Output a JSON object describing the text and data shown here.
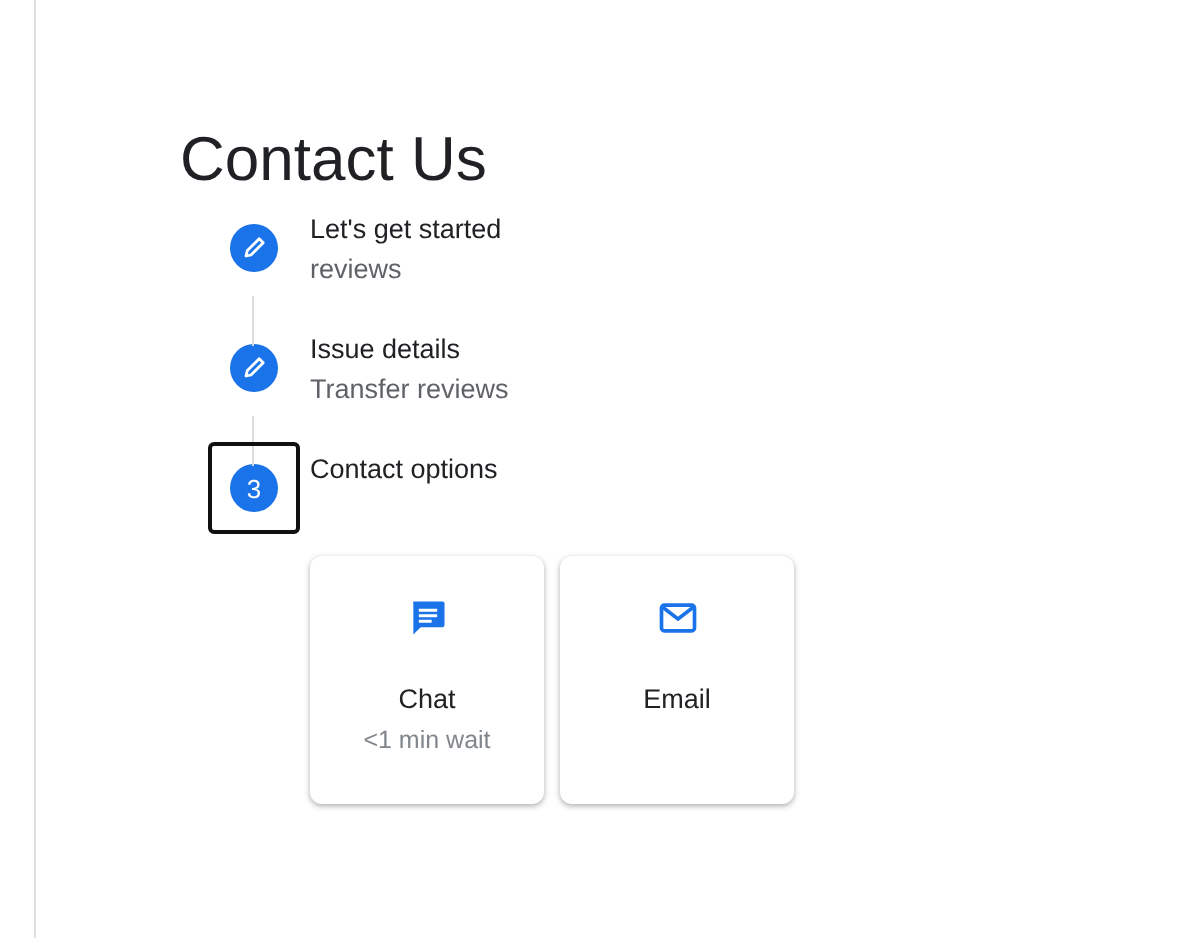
{
  "title": "Contact Us",
  "steps": [
    {
      "kind": "done",
      "label": "Let's get started",
      "detail": "reviews",
      "focused": false
    },
    {
      "kind": "done",
      "label": "Issue details",
      "detail": "Transfer reviews",
      "focused": false
    },
    {
      "kind": "current",
      "number": "3",
      "label": "Contact options",
      "focused": true
    }
  ],
  "options": [
    {
      "kind": "chat",
      "label": "Chat",
      "detail": "<1 min wait"
    },
    {
      "kind": "email",
      "label": "Email"
    }
  ]
}
